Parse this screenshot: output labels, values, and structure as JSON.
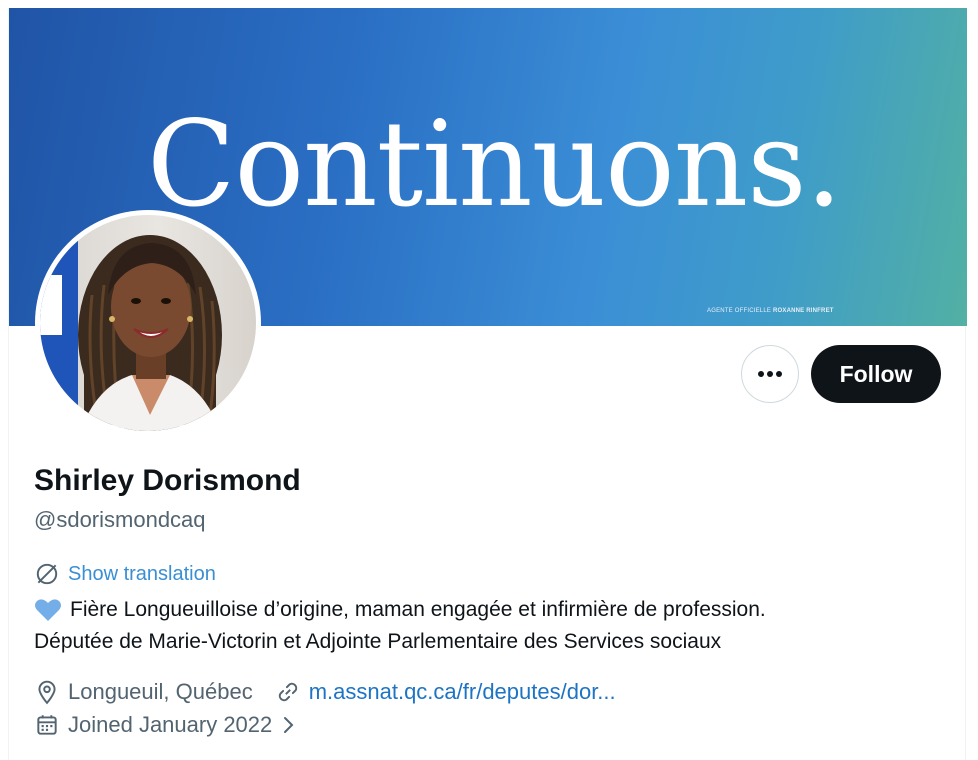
{
  "banner": {
    "headline": "Continuons.",
    "credit_prefix": "AGENTE OFFICIELLE",
    "credit_name": "ROXANNE RINFRET"
  },
  "actions": {
    "more_label": "•••",
    "follow_label": "Follow"
  },
  "profile": {
    "name": "Shirley Dorismond",
    "handle": "@sdorismondcaq",
    "translation_label": "Show translation",
    "bio_line1": "Fière Longueuilloise d’origine, maman engagée et infirmière de profession.",
    "bio_line2": "Députée de Marie-Victorin et Adjointe Parlementaire des Services sociaux",
    "location": "Longueuil, Québec",
    "website": "m.assnat.qc.ca/fr/deputes/dor...",
    "joined": "Joined January 2022"
  },
  "icons": {
    "translate": "translate-icon",
    "heart": "blue-heart-emoji",
    "location": "location-pin-icon",
    "link": "link-icon",
    "calendar": "calendar-icon",
    "chevron": "chevron-right-icon"
  },
  "colors": {
    "accent_link": "#1d9bf0",
    "follow_bg": "#0f1419",
    "banner_start": "#2054a6",
    "banner_end": "#52b0a4",
    "heart": "#6fa8e8"
  }
}
